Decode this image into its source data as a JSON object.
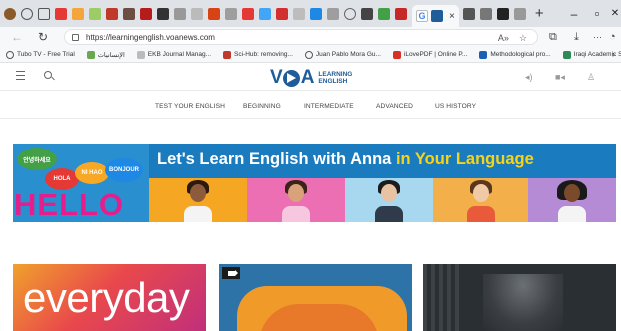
{
  "browser": {
    "active_tab_close": "×",
    "new_tab": "+",
    "window_controls": {
      "minimize": "–",
      "maximize": "▫",
      "close": "✕"
    },
    "address": {
      "url": "https://learningenglish.voanews.com",
      "read_aloud": "A»",
      "favorite": "☆"
    },
    "toolbar": {
      "collections": "⧉",
      "downloads": "⤓",
      "more": "···",
      "profile": "◔"
    },
    "bookmarks": [
      {
        "label": "Tubo TV - Free Trial",
        "icon": "globe-icon",
        "color": "#555555"
      },
      {
        "label": "الإنسانيات",
        "icon": "site-icon",
        "color": "#6aa84f"
      },
      {
        "label": "EKB Journal Manag...",
        "icon": "doc-icon",
        "color": "#bbbbbb"
      },
      {
        "label": "Sci-Hub: removing...",
        "icon": "scihub-icon",
        "color": "#c0392b"
      },
      {
        "label": "Juan Pablo Mora Gu...",
        "icon": "globe-icon",
        "color": "#555555"
      },
      {
        "label": "iLovePDF | Online P...",
        "icon": "heart-icon",
        "color": "#d93025"
      },
      {
        "label": "Methodological pro...",
        "icon": "s-icon",
        "color": "#1a5fb4"
      },
      {
        "label": "Iraqi Academic Scie...",
        "icon": "journal-icon",
        "color": "#2e8b57"
      }
    ],
    "bookmarks_more": "›"
  },
  "site": {
    "logo": {
      "mark": "VOA",
      "line1": "LEARNING",
      "line2": "ENGLISH"
    },
    "header_icons": [
      "audio-icon",
      "video-icon",
      "user-icon"
    ],
    "nav": [
      "TEST YOUR ENGLISH",
      "BEGINNING",
      "INTERMEDIATE",
      "ADVANCED",
      "US HISTORY"
    ],
    "banner": {
      "headline_start": "Let's Learn English with Anna",
      "headline_highlight": "in Your Language",
      "hello": "HELLO",
      "bubbles": [
        "안녕하세요",
        "HOLA",
        "NI HAO",
        "BONJOUR"
      ]
    },
    "cards": [
      {
        "title": "everyday"
      },
      {
        "badge": "video-icon"
      },
      {
        "image": "photo"
      }
    ]
  },
  "colors": {
    "brand_blue": "#1f5c9a",
    "banner_blue": "#1b7bbf",
    "highlight_yellow": "#f7d418",
    "hello_pink": "#e61d8c"
  }
}
